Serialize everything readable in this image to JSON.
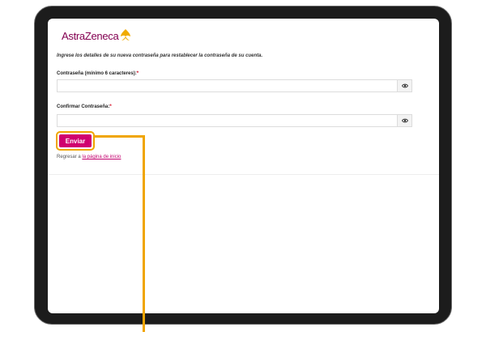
{
  "brand": {
    "name": "AstraZeneca",
    "logo_icon": "astrazeneca-logo-icon",
    "color": "#830051"
  },
  "form": {
    "instructions": "Ingrese los detalles de su nueva contraseña para restablecer la contraseña de su cuenta.",
    "password_label": "Contraseña (mínimo 6 caracteres):",
    "password_value": "",
    "confirm_label": "Confirmar Contraseña:",
    "confirm_value": "",
    "required_marker": "*",
    "show_password_icon": "eye-icon",
    "submit_label": "Enviar",
    "back_prefix": "Regresar a",
    "back_link": "la página de inicio"
  },
  "colors": {
    "submit": "#d0006f",
    "link": "#c3006e",
    "highlight": "#f0a500",
    "required": "#d0021b"
  }
}
